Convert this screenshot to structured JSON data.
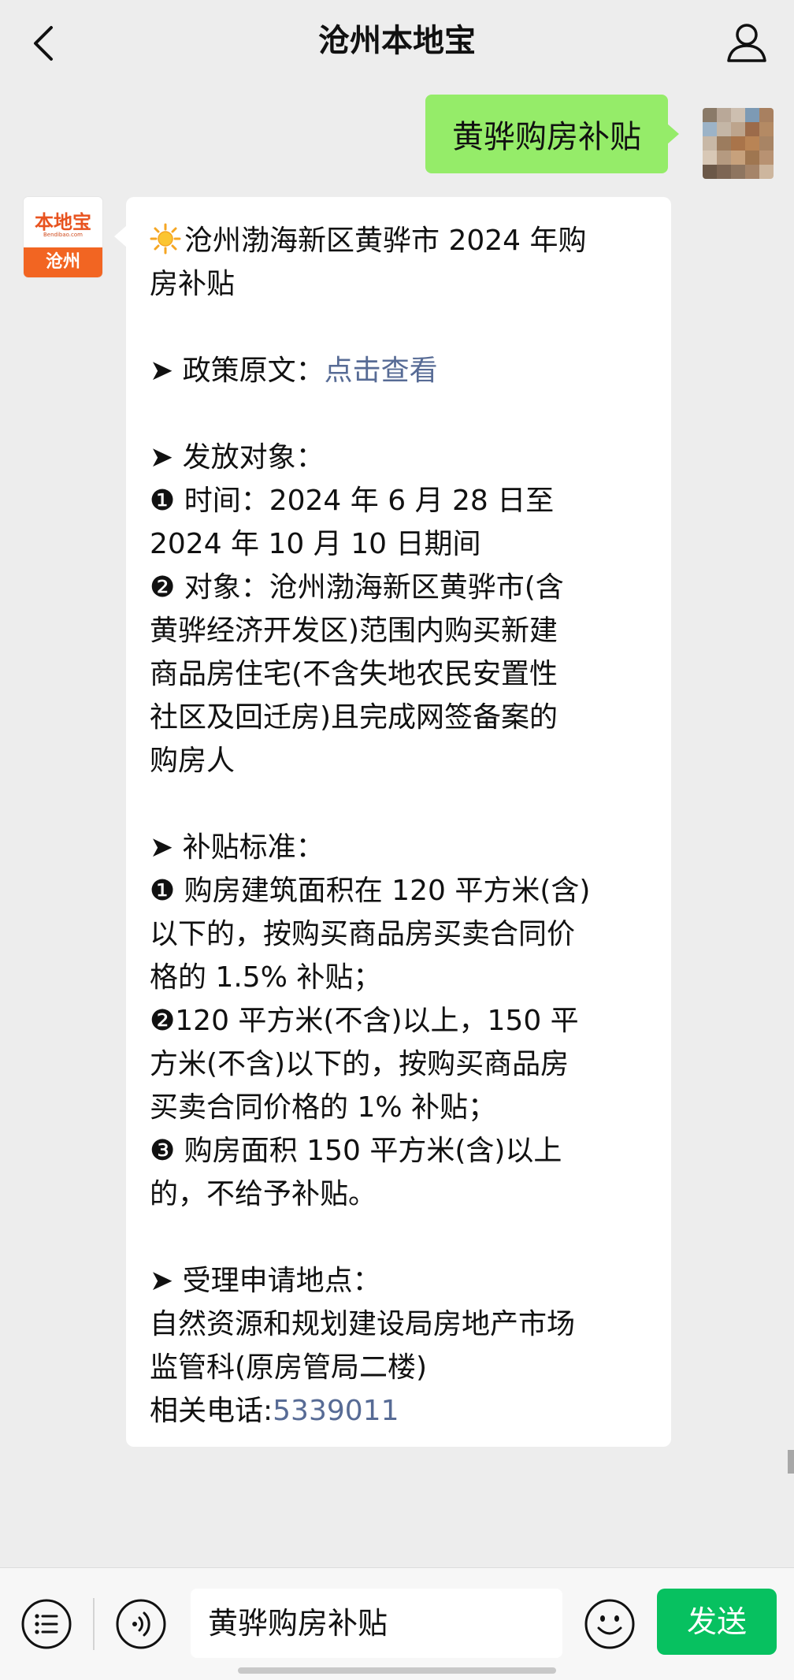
{
  "header": {
    "title": "沧州本地宝",
    "back_icon": "chevron-left-icon",
    "profile_icon": "person-icon"
  },
  "outgoing_message": {
    "text": "黄骅购房补贴"
  },
  "incoming_sender": {
    "logo_text": "本地宝",
    "logo_sub": "Bendibao.com",
    "logo_city": "沧州"
  },
  "incoming_message": {
    "title_line1": "沧州渤海新区黄骅市 2024 年购",
    "title_line2": "房补贴",
    "policy_label": "➤ 政策原文：",
    "policy_link": "点击查看",
    "target_heading": "➤ 发放对象：",
    "target_lines": [
      "❶ 时间：2024 年 6 月 28 日至",
      "2024 年 10 月 10 日期间",
      "❷ 对象：沧州渤海新区黄骅市(含",
      "黄骅经济开发区)范围内购买新建",
      "商品房住宅(不含失地农民安置性",
      "社区及回迁房)且完成网签备案的",
      "购房人"
    ],
    "standard_heading": "➤ 补贴标准：",
    "standard_lines": [
      "❶ 购房建筑面积在 120 平方米(含)",
      "以下的，按购买商品房买卖合同价",
      "格的 1.5% 补贴；",
      "❷120 平方米(不含)以上，150 平",
      "方米(不含)以下的，按购买商品房",
      "买卖合同价格的 1% 补贴；",
      "❸ 购房面积 150 平方米(含)以上",
      "的，不给予补贴。"
    ],
    "location_heading": "➤ 受理申请地点：",
    "location_lines": [
      "自然资源和规划建设局房地产市场",
      "监管科(原房管局二楼)"
    ],
    "phone_label": "相关电话:",
    "phone_number": "5339011"
  },
  "bottom_bar": {
    "menu_icon": "list-menu-icon",
    "voice_icon": "voice-icon",
    "input_value": "黄骅购房补贴",
    "emoji_icon": "emoji-icon",
    "send_label": "发送"
  },
  "colors": {
    "outgoing_bubble": "#95ec69",
    "link": "#576b95",
    "send_button": "#07c160",
    "background": "#ededed"
  }
}
